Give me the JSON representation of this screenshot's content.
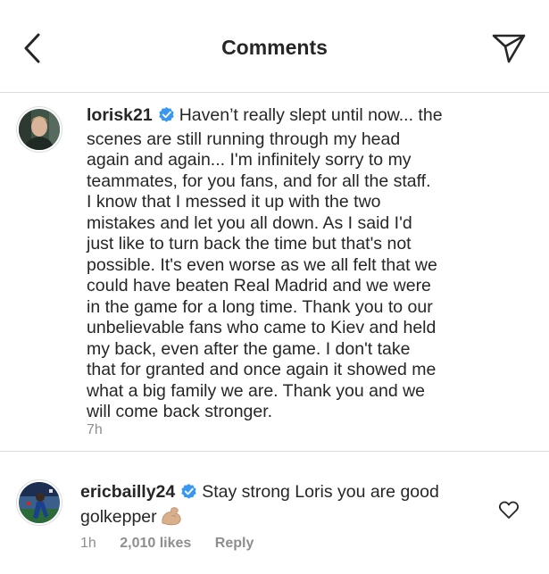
{
  "header": {
    "title": "Comments",
    "back_icon": "chevron-left-icon",
    "share_icon": "direct-send-icon"
  },
  "caption": {
    "username": "lorisk21",
    "verified": true,
    "text": "Haven’t really slept until now... the\nscenes are still running through my head\nagain and again... I'm infinitely sorry to my\nteammates, for you fans, and for all the staff.\nI know that I messed it up with the two\nmistakes and let you all down. As I said I'd\njust like to turn back the time but that's not\npossible. It's even worse as we all felt that we\ncould have beaten Real Madrid and we were\nin the game for a long time. Thank you to our\nunbelievable fans who came to Kiev and held\nmy back, even after the game. I don't take\nthat for granted and once again it showed me\nwhat a big family we are. Thank you and we\nwill come back stronger.",
    "time": "7h"
  },
  "comments": [
    {
      "username": "ericbailly24",
      "verified": true,
      "text": "Stay strong Loris you are good\ngolkepper",
      "emoji": "flexed-biceps-emoji",
      "time": "1h",
      "likes": "2,010 likes",
      "reply_label": "Reply"
    }
  ],
  "colors": {
    "text": "#262626",
    "secondary": "#8e8e8e",
    "verified_blue": "#3897f0",
    "divider": "#dbdbdb"
  }
}
